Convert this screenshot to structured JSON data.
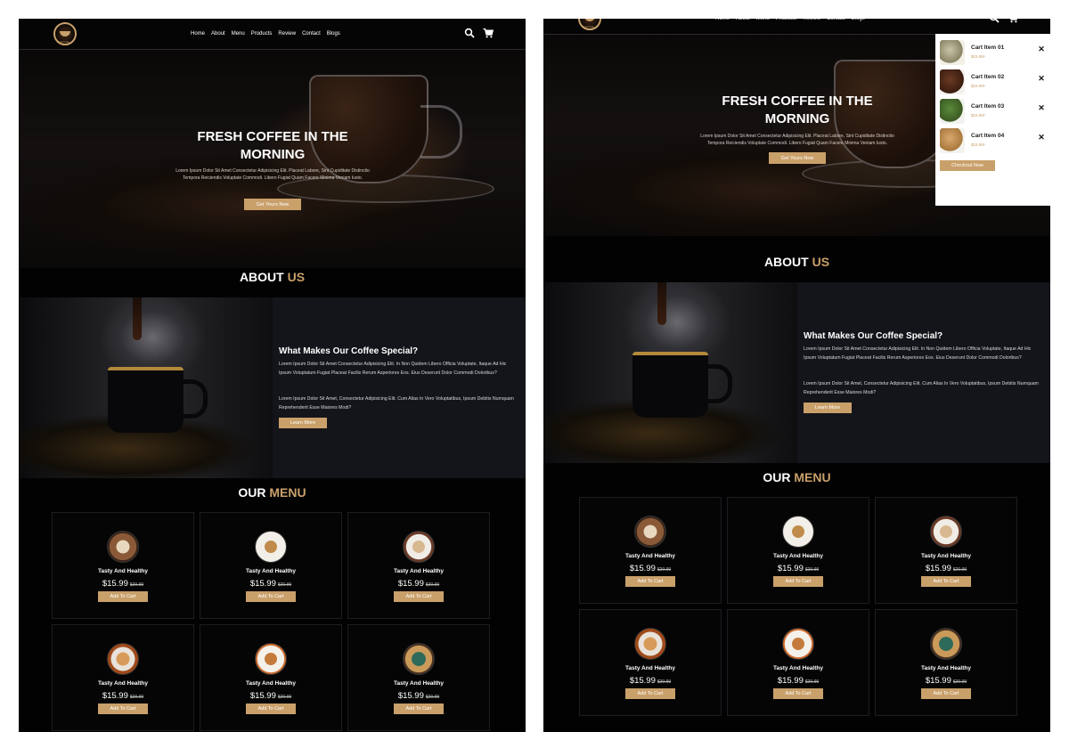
{
  "brand": {
    "logo_text": "COFFEE"
  },
  "nav": {
    "links": [
      "Home",
      "About",
      "Menu",
      "Products",
      "Review",
      "Contact",
      "Blogs"
    ]
  },
  "icons": {
    "search": "search-icon",
    "cart": "cart-icon",
    "close": "close-icon"
  },
  "hero": {
    "title": "FRESH COFFEE IN THE MORNING",
    "text": "Lorem Ipsum Dolor Sit Amet Consectetur Adipisicing Elit. Placeat Labore, Sint Cupiditate Distinctio Tempora Reiciendis Voluptate Commodi. Libero Fugiat Quam Facere Minima Veniam Iusto.",
    "button": "Get Yours Now"
  },
  "about": {
    "heading": "ABOUT",
    "heading_accent": "US",
    "title": "What Makes Our Coffee Special?",
    "p1": "Lorem Ipsum Dolor Sit Amet Consectetur Adipisicing Elit. In Non Quidem Libero Officia Voluptate, Itaque Ad Hic Ipsum Voluptatum Fugiat Placeat Facilis Rerum Asperiores Eos. Eius Deserunt Dolor Commodi Doloribus?",
    "p2": "Lorem Ipsum Dolor Sit Amet, Consectetur Adipisicing Elit. Cum Alias In Vero Voluptatibus, Ipsum Debitis Numquam Reprehenderit Esse Maiores Modi?",
    "button": "Learn More"
  },
  "menu": {
    "heading": "OUR",
    "heading_accent": "MENU",
    "items": [
      {
        "name": "Tasty And Healthy",
        "price": "$15.99",
        "old_price": "$20.99",
        "button": "Add To Cart"
      },
      {
        "name": "Tasty And Healthy",
        "price": "$15.99",
        "old_price": "$20.99",
        "button": "Add To Cart"
      },
      {
        "name": "Tasty And Healthy",
        "price": "$15.99",
        "old_price": "$20.99",
        "button": "Add To Cart"
      },
      {
        "name": "Tasty And Healthy",
        "price": "$15.99",
        "old_price": "$20.99",
        "button": "Add To Cart"
      },
      {
        "name": "Tasty And Healthy",
        "price": "$15.99",
        "old_price": "$20.99",
        "button": "Add To Cart"
      },
      {
        "name": "Tasty And Healthy",
        "price": "$15.99",
        "old_price": "$20.99",
        "button": "Add To Cart"
      }
    ]
  },
  "cart": {
    "items": [
      {
        "name": "Cart Item 01",
        "price": "$15.99/-"
      },
      {
        "name": "Cart Item 02",
        "price": "$15.99/-"
      },
      {
        "name": "Cart Item 03",
        "price": "$15.99/-"
      },
      {
        "name": "Cart Item 04",
        "price": "$15.99/-"
      }
    ],
    "checkout": "Checkout Now"
  },
  "colors": {
    "accent": "#c9a06a",
    "background": "#020203",
    "about_bg": "#14151a"
  }
}
